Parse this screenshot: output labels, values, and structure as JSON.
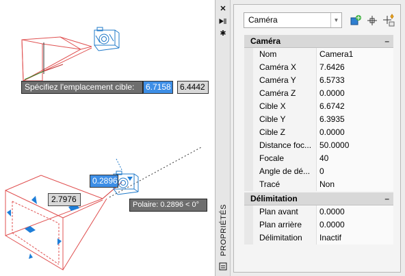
{
  "canvas": {
    "tooltip_prompt": "Spécifiez l'emplacement cible:",
    "input_x": "6.7158",
    "input_y": "6.4442",
    "dim_value_1": "0.2896",
    "dim_value_2": "2.7976",
    "polar_tooltip": "Polaire: 0.2896 < 0°"
  },
  "palette": {
    "side_title": "PROPRIÉTÉS",
    "object_select": "Caméra",
    "sections": [
      {
        "title": "Caméra",
        "collapse": "–",
        "rows": [
          {
            "name": "Nom",
            "value": "Camera1"
          },
          {
            "name": "Caméra X",
            "value": "7.6426"
          },
          {
            "name": "Caméra Y",
            "value": "6.5733"
          },
          {
            "name": "Caméra Z",
            "value": "0.0000"
          },
          {
            "name": "Cible X",
            "value": "6.6742"
          },
          {
            "name": "Cible Y",
            "value": "6.3935"
          },
          {
            "name": "Cible Z",
            "value": "0.0000"
          },
          {
            "name": "Distance foc...",
            "value": "50.0000"
          },
          {
            "name": "Focale",
            "value": "40"
          },
          {
            "name": "Angle de dé...",
            "value": "0"
          },
          {
            "name": "Tracé",
            "value": "Non"
          }
        ]
      },
      {
        "title": "Délimitation",
        "collapse": "–",
        "rows": [
          {
            "name": "Plan avant",
            "value": "0.0000"
          },
          {
            "name": "Plan arrière",
            "value": "0.0000"
          },
          {
            "name": "Délimitation",
            "value": "Inactif"
          }
        ]
      }
    ]
  },
  "icons": {
    "close": "close-icon",
    "autohide": "autohide-icon",
    "settings": "gear-icon",
    "quick_select": "quick-select-icon",
    "select_objects": "select-objects-icon",
    "toggle_pickadd": "toggle-pickadd-icon"
  },
  "colors": {
    "frustum": "#e05050",
    "camera": "#1e78c8",
    "grip": "#1e7ed8",
    "selection": "#3d8ee6"
  }
}
